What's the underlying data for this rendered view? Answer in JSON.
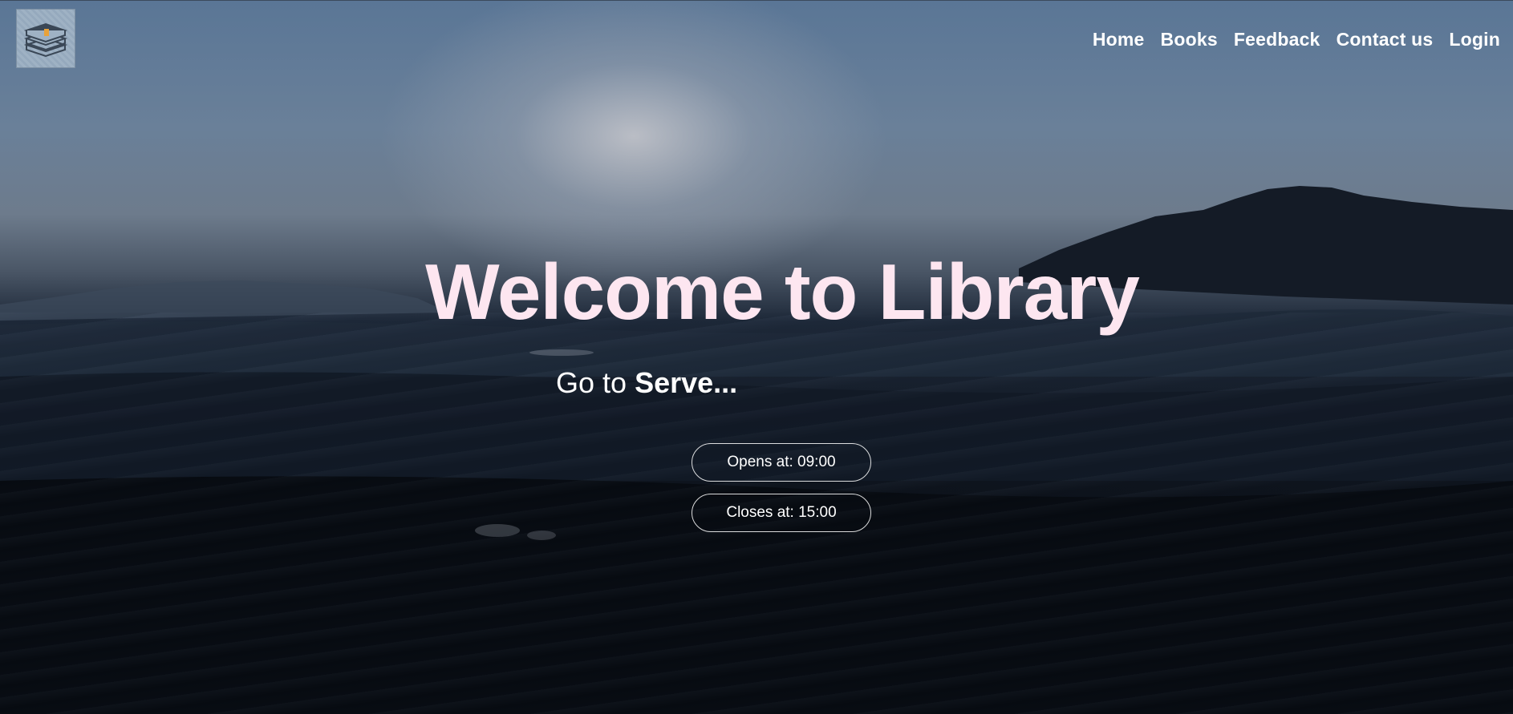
{
  "nav": {
    "items": [
      {
        "label": "Home"
      },
      {
        "label": "Books"
      },
      {
        "label": "Feedback"
      },
      {
        "label": "Contact us"
      },
      {
        "label": "Login"
      }
    ]
  },
  "hero": {
    "title": "Welcome to Library",
    "subtitle_prefix": "Go to ",
    "subtitle_strong": "Serve...",
    "opens": "Opens at: 09:00",
    "closes": "Closes at: 15:00"
  },
  "logo": {
    "icon": "books-stack-icon"
  },
  "colors": {
    "title": "#fde6f0",
    "nav_text": "#ffffff",
    "pill_border": "#ffffff"
  }
}
